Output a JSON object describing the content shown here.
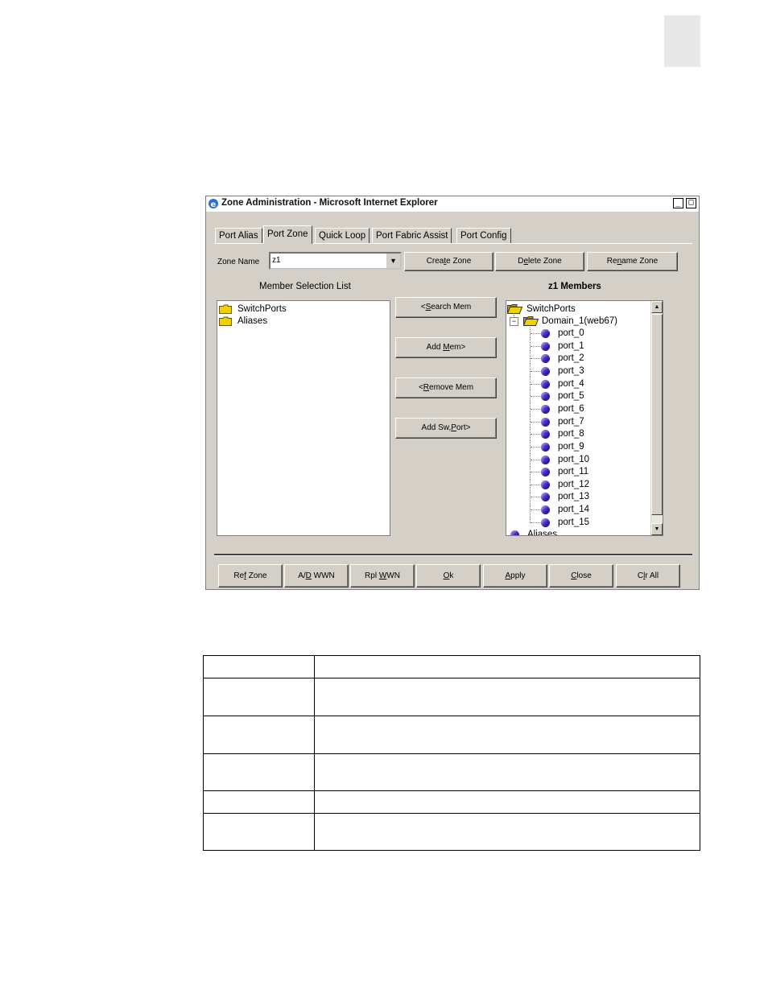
{
  "window": {
    "title": "Zone Administration - Microsoft Internet Explorer",
    "minimize_symbol": "_",
    "maximize_symbol": "□"
  },
  "tabs": [
    {
      "label": "Port Alias",
      "active": false
    },
    {
      "label": "Port Zone",
      "active": true
    },
    {
      "label": "Quick Loop",
      "active": false
    },
    {
      "label": "Port Fabric Assist",
      "active": false
    },
    {
      "label": "Port Config",
      "active": false
    }
  ],
  "zone": {
    "name_label": "Zone Name",
    "selected_value": "z1",
    "create_label": "Create Zone",
    "delete_label": "Delete Zone",
    "rename_label": "Rename Zone"
  },
  "member_selection": {
    "heading": "Member Selection List",
    "items": [
      "SwitchPorts",
      "Aliases"
    ]
  },
  "actions": {
    "search_mem": "<Search Mem",
    "add_mem": "Add Mem>",
    "remove_mem": "<Remove Mem",
    "add_swport": "Add Sw,Port>"
  },
  "members": {
    "heading": "z1 Members",
    "root": "SwitchPorts",
    "domain": "Domain_1(web67)",
    "expander": "−",
    "ports": [
      "port_0",
      "port_1",
      "port_2",
      "port_3",
      "port_4",
      "port_5",
      "port_6",
      "port_7",
      "port_8",
      "port_9",
      "port_10",
      "port_11",
      "port_12",
      "port_13",
      "port_14",
      "port_15"
    ],
    "partial_item": "Aliases"
  },
  "bottom_buttons": {
    "ref_zone": "Ref Zone",
    "ad_wwn": "A/D WWN",
    "rpl_wwn": "Rpl WWN",
    "ok": "Ok",
    "apply": "Apply",
    "close": "Close",
    "clr_all": "Clr All"
  },
  "colors": {
    "dialog_bg": "#d4d0c8",
    "member_dot": "#4a2cd8",
    "folder": "#f0d000"
  }
}
